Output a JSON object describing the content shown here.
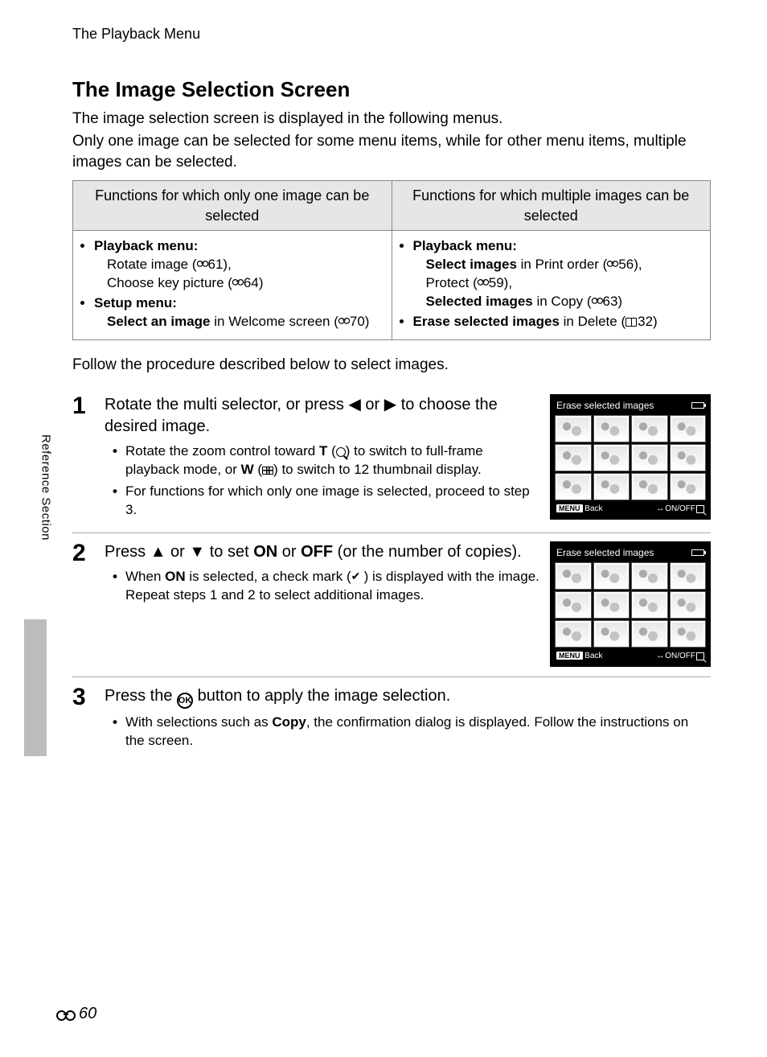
{
  "breadcrumb": "The Playback Menu",
  "heading": "The Image Selection Screen",
  "intro_line1": "The image selection screen is displayed in the following menus.",
  "intro_line2": "Only one image can be selected for some menu items, while for other menu items, multiple images can be selected.",
  "table": {
    "header_left": "Functions for which only one image can be selected",
    "header_right": "Functions for which multiple images can be selected",
    "left": {
      "pb_label": "Playback menu:",
      "rotate_pre": "Rotate image (",
      "rotate_ref": "61),",
      "keypic_pre": "Choose key picture (",
      "keypic_ref": "64)",
      "setup_label": "Setup menu:",
      "select_img_bold": "Select an image",
      "select_img_rest": " in Welcome screen (",
      "select_img_ref": "70)"
    },
    "right": {
      "pb_label": "Playback menu:",
      "sel_images_bold": "Select images",
      "sel_images_rest": " in Print order (",
      "sel_images_ref": "56),",
      "protect_pre": "Protect (",
      "protect_ref": "59),",
      "selected_bold": "Selected images",
      "selected_rest": " in Copy (",
      "selected_ref": "63)",
      "erase_bold": "Erase selected images",
      "erase_rest": " in Delete (",
      "erase_book_ref": "32)"
    }
  },
  "follow_text": "Follow the procedure described below to select images.",
  "steps": [
    {
      "num": "1",
      "head_pre": "Rotate the multi selector, or press ",
      "head_mid": " or ",
      "head_post": " to choose the desired image.",
      "bullets": [
        {
          "pre": "Rotate the zoom control toward ",
          "t": "T",
          "mid1": " (",
          "mid2": ") to switch to full-frame playback mode, or ",
          "w": "W",
          "mid3": " (",
          "mid4": ") to switch to 12 thumbnail display."
        },
        {
          "text": "For functions for which only one image is selected, proceed to step 3."
        }
      ],
      "screen": {
        "title": "Erase selected images",
        "back": "Back",
        "onoff": "ON/OFF"
      }
    },
    {
      "num": "2",
      "head_pre": "Press ",
      "head_mid": " or ",
      "head_post1": " to set ",
      "on": "ON",
      "or": " or ",
      "off": "OFF",
      "head_post2": " (or the number of copies).",
      "bullets": [
        {
          "pre": "When ",
          "on": "ON",
          "mid": " is selected, a check mark (",
          "post": ") is displayed with the image. Repeat steps 1 and 2 to select additional images."
        }
      ],
      "screen": {
        "title": "Erase selected images",
        "back": "Back",
        "onoff": "ON/OFF"
      }
    },
    {
      "num": "3",
      "head_pre": "Press the ",
      "head_post": " button to apply the image selection.",
      "bullets": [
        {
          "pre": "With selections such as ",
          "copy": "Copy",
          "post": ", the confirmation dialog is displayed. Follow the instructions on the screen."
        }
      ]
    }
  ],
  "side_label": "Reference Section",
  "page_number": "60"
}
